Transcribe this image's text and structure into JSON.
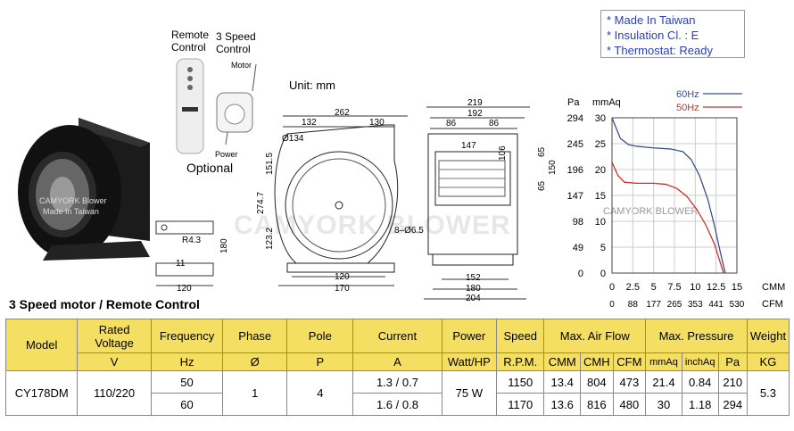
{
  "notes": [
    "* Made In Taiwan",
    "* Insulation Cl. : E",
    "* Thermostat: Ready"
  ],
  "labels": {
    "remote_control": [
      "Remote",
      "Control"
    ],
    "speed_control": [
      "3 Speed",
      "Control"
    ],
    "motor": "Motor",
    "power": "Power",
    "optional": "Optional",
    "unit": "Unit: mm",
    "watermark": "CAMYORK BLOWER",
    "watermark_small": "CAMYORK BLOWER",
    "photo_brand": "CAMYORK Blower",
    "photo_made": "Made In Taiwan"
  },
  "dims": {
    "d262": "262",
    "d132": "132",
    "d130": "130",
    "d134": "Ø134",
    "d151_5": "151.5",
    "d274_7": "274.7",
    "d123_2": "123.2",
    "d120": "120",
    "d170": "170",
    "d8": "8–Ø6.5",
    "d219": "219",
    "d192": "192",
    "d86a": "86",
    "d86b": "86",
    "d147": "147",
    "d106": "106",
    "d65a": "65",
    "d65b": "65",
    "d150": "150",
    "d152": "152",
    "d180": "180",
    "d204": "204",
    "r4_3": "R4.3",
    "b180": "180",
    "b11": "11",
    "b120": "120"
  },
  "chart_data": {
    "type": "line",
    "units_left": "Pa",
    "units_left2": "mmAq",
    "yticks_pa": [
      294,
      245,
      196,
      147,
      98,
      49,
      0
    ],
    "yticks_mmaq": [
      30,
      25,
      20,
      15,
      10,
      5,
      0
    ],
    "xticks_cmm": [
      "0",
      "2.5",
      "5",
      "7.5",
      "10",
      "12.5",
      "15"
    ],
    "xticks_cfm": [
      "0",
      "88",
      "177",
      "265",
      "353",
      "441",
      "530"
    ],
    "xunit1": "CMM",
    "xunit2": "CFM",
    "ylim": [
      0,
      294
    ],
    "xlim": [
      0,
      15
    ],
    "series": [
      {
        "name": "60Hz",
        "color": "#3b4f8c",
        "x": [
          0,
          1,
          2,
          3,
          5,
          7,
          8.5,
          9.5,
          10.5,
          11.5,
          12.3,
          13,
          13.6
        ],
        "y": [
          294,
          255,
          243,
          240,
          237,
          235,
          230,
          215,
          185,
          140,
          90,
          40,
          0
        ]
      },
      {
        "name": "50Hz",
        "color": "#c9302c",
        "x": [
          0,
          0.7,
          1.5,
          3,
          5,
          6.5,
          7.8,
          9,
          10.2,
          11.3,
          12.3,
          13.0,
          13.4
        ],
        "y": [
          210,
          185,
          172,
          170,
          170,
          168,
          160,
          145,
          120,
          90,
          55,
          20,
          0
        ]
      }
    ]
  },
  "section_title": "3 Speed motor / Remote Control",
  "table": {
    "headers": [
      "Model",
      "Rated Voltage",
      "Frequency",
      "Phase",
      "Pole",
      "Current",
      "Power",
      "Speed",
      "Max. Air Flow",
      "Max. Pressure",
      "Weight"
    ],
    "units": [
      "V",
      "Hz",
      "Ø",
      "P",
      "A",
      "Watt/HP",
      "R.P.M.",
      "CMM",
      "CMH",
      "CFM",
      "mmAq",
      "inchAq",
      "Pa",
      "KG"
    ],
    "model": "CY178DM",
    "voltage": "110/220",
    "phase": "1",
    "pole": "4",
    "power": "75 W",
    "weight": "5.3",
    "rows": [
      {
        "freq": "50",
        "current": "1.3 / 0.7",
        "speed": "1150",
        "cmm": "13.4",
        "cmh": "804",
        "cfm": "473",
        "mmaq": "21.4",
        "inchaq": "0.84",
        "pa": "210"
      },
      {
        "freq": "60",
        "current": "1.6 / 0.8",
        "speed": "1170",
        "cmm": "13.6",
        "cmh": "816",
        "cfm": "480",
        "mmaq": "30",
        "inchaq": "1.18",
        "pa": "294"
      }
    ]
  }
}
